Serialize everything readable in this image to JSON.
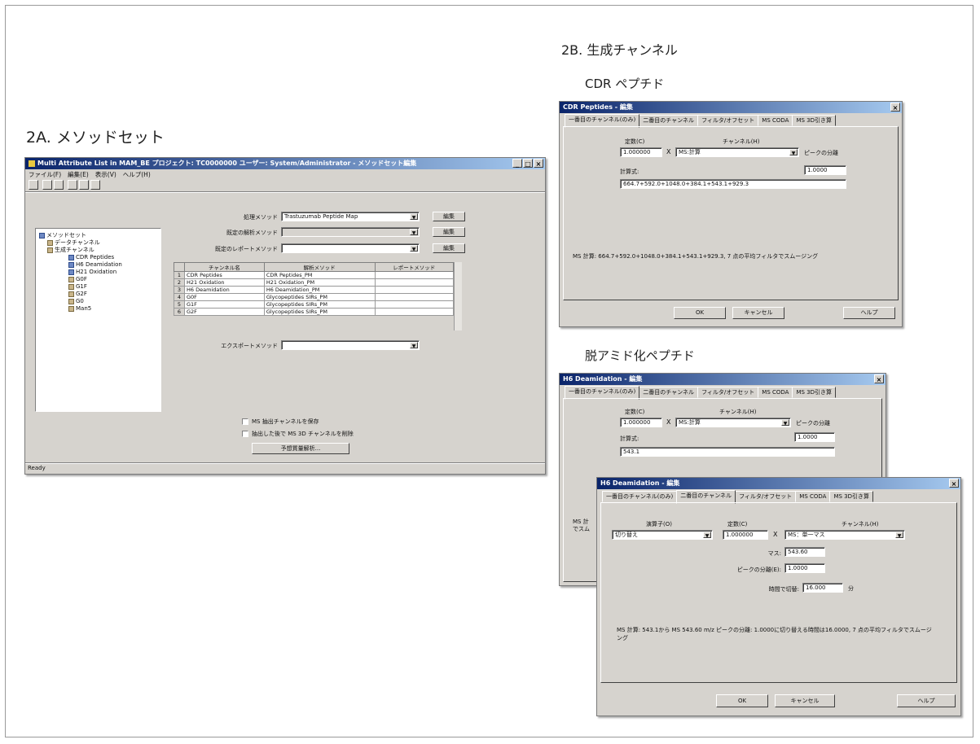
{
  "headings": {
    "h2a": "2A. メソッドセット",
    "h2b": "2B. 生成チャンネル",
    "cdr": "CDR ペプチド",
    "deamid": "脱アミド化ペプチド"
  },
  "win_a": {
    "title": "Multi Attribute List in MAM_BE プロジェクト: TC0000000 ユーザー: System/Administrator - メソッドセット編集",
    "menus": [
      "ファイル(F)",
      "編集(E)",
      "表示(V)",
      "ヘルプ(H)"
    ],
    "labels": {
      "process": "処理メソッド",
      "analysis": "既定の解析メソッド",
      "report": "既定のレポートメソッド",
      "export": "エクスポートメソッド"
    },
    "process_value": "Trastuzumab Peptide Map",
    "edit_btn": "編集",
    "tree": [
      "メソッドセット",
      "データチャンネル",
      "生成チャンネル",
      "CDR Peptides",
      "H6 Deamidation",
      "H21 Oxidation",
      "G0F",
      "G1F",
      "G2F",
      "G0",
      "Man5"
    ],
    "grid_headers": [
      "チャンネル名",
      "解析メソッド",
      "レポートメソッド"
    ],
    "grid_rows": [
      {
        "n": "1",
        "name": "CDR Peptides",
        "method": "CDR Peptides_PM"
      },
      {
        "n": "2",
        "name": "H21 Oxidation",
        "method": "H21 Oxidation_PM"
      },
      {
        "n": "3",
        "name": "H6 Deamidation",
        "method": "H6 Deamidation_PM"
      },
      {
        "n": "4",
        "name": "G0F",
        "method": "Glycopeptides SIRs_PM"
      },
      {
        "n": "5",
        "name": "G1F",
        "method": "Glycopeptides SIRs_PM"
      },
      {
        "n": "6",
        "name": "G2F",
        "method": "Glycopeptides SIRs_PM"
      }
    ],
    "check1": "MS 抽出チャンネルを保存",
    "check2": "抽出した後で MS 3D チャンネルを削除",
    "analysis_btn": "予想質量解析...",
    "status": "Ready"
  },
  "win_cdr": {
    "title": "CDR Peptides - 編集",
    "tabs": [
      "一番目のチャンネル(のみ)",
      "二番目のチャンネル",
      "フィルタ/オフセット",
      "MS CODA",
      "MS 3D引き算"
    ],
    "const_label": "定数(C)",
    "channel_label": "チャンネル(H)",
    "const_value": "1.000000",
    "times": "X",
    "channel_value": "MS:計算",
    "peak_label": "ピークの分離",
    "calc_label": "計算式:",
    "peak_value": "1.0000",
    "formula": "664.7+592.0+1048.0+384.1+543.1+929.3",
    "summary": "MS 計算: 664.7+592.0+1048.0+384.1+543.1+929.3, 7 点の平均フィルタでスムージング",
    "ok": "OK",
    "cancel": "キャンセル",
    "help": "ヘルプ"
  },
  "win_h6a": {
    "title": "H6 Deamidation - 編集",
    "tabs": [
      "一番目のチャンネル(のみ)",
      "二番目のチャンネル",
      "フィルタ/オフセット",
      "MS CODA",
      "MS 3D引き算"
    ],
    "const_label": "定数(C)",
    "channel_label": "チャンネル(H)",
    "const_value": "1.000000",
    "times": "X",
    "channel_value": "MS:計算",
    "peak_label": "ピークの分離",
    "calc_label": "計算式:",
    "peak_value": "1.0000",
    "formula": "543.1",
    "side_text": "MS 計\nでスム"
  },
  "win_h6b": {
    "title": "H6 Deamidation - 編集",
    "tabs": [
      "一番目のチャンネル(のみ)",
      "二番目のチャンネル",
      "フィルタ/オフセット",
      "MS CODA",
      "MS 3D引き算"
    ],
    "op_label": "演算子(O)",
    "const_label": "定数(C)",
    "channel_label": "チャンネル(H)",
    "op_value": "切り替え",
    "const_value": "1.000000",
    "times": "X",
    "channel_value": "MS：単一マス",
    "mass_label": "マス:",
    "mass_value": "543.60",
    "peak_label": "ピークの分離(E):",
    "peak_value": "1.0000",
    "time_label": "時間で切替:",
    "time_value": "16.000",
    "time_unit": "分",
    "summary": "MS 計算: 543.1から MS 543.60 m/z ピークの分離: 1.0000に切り替える時間は16.0000, 7 点の平均フィルタでスムージング",
    "ok": "OK",
    "cancel": "キャンセル",
    "help": "ヘルプ"
  },
  "colors": {
    "dialog_bg": "#d6d3ce",
    "titlebar_start": "#0a246a",
    "titlebar_end": "#a6caf0"
  }
}
